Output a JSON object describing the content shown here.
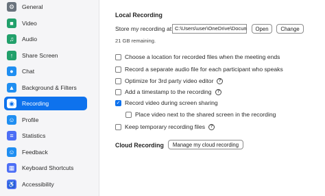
{
  "colors": {
    "accent": "#0e72ed",
    "sidebar_bg": "#f5f5f7"
  },
  "sidebar": {
    "items": [
      {
        "label": "General",
        "icon": "gear-icon",
        "glyph": "⚙",
        "color": "#6a737d"
      },
      {
        "label": "Video",
        "icon": "video-icon",
        "glyph": "■",
        "color": "#22a06b"
      },
      {
        "label": "Audio",
        "icon": "headphones-icon",
        "glyph": "♫",
        "color": "#22a06b"
      },
      {
        "label": "Share Screen",
        "icon": "share-screen-icon",
        "glyph": "↑",
        "color": "#22a06b"
      },
      {
        "label": "Chat",
        "icon": "chat-icon",
        "glyph": "●",
        "color": "#1f8ef1"
      },
      {
        "label": "Background & Filters",
        "icon": "background-icon",
        "glyph": "▲",
        "color": "#1f8ef1"
      },
      {
        "label": "Recording",
        "icon": "record-icon",
        "glyph": "◉",
        "color": "#0e72ed",
        "active": true
      },
      {
        "label": "Profile",
        "icon": "profile-icon",
        "glyph": "☺",
        "color": "#1f8ef1"
      },
      {
        "label": "Statistics",
        "icon": "statistics-icon",
        "glyph": "≡",
        "color": "#4c6ef5"
      },
      {
        "label": "Feedback",
        "icon": "feedback-icon",
        "glyph": "☺",
        "color": "#1f8ef1"
      },
      {
        "label": "Keyboard Shortcuts",
        "icon": "keyboard-icon",
        "glyph": "▦",
        "color": "#4c6ef5"
      },
      {
        "label": "Accessibility",
        "icon": "accessibility-icon",
        "glyph": "♿",
        "color": "#4c6ef5"
      }
    ]
  },
  "local": {
    "title": "Local Recording",
    "store_label": "Store my recording at:",
    "path": "C:\\Users\\user\\OneDrive\\Docume",
    "open_label": "Open",
    "change_label": "Change",
    "remaining": "21 GB remaining.",
    "options": [
      {
        "label": "Choose a location for recorded files when the meeting ends",
        "checked": false
      },
      {
        "label": "Record a separate audio file for each participant who speaks",
        "checked": false
      },
      {
        "label": "Optimize for 3rd party video editor",
        "checked": false,
        "help": true
      },
      {
        "label": "Add a timestamp to the recording",
        "checked": false,
        "help": true
      },
      {
        "label": "Record video during screen sharing",
        "checked": true
      },
      {
        "label": "Place video next to the shared screen in the recording",
        "checked": false,
        "indent": true
      },
      {
        "label": "Keep temporary recording files",
        "checked": false,
        "help": true
      }
    ]
  },
  "cloud": {
    "title": "Cloud Recording",
    "manage_label": "Manage my cloud recording"
  }
}
